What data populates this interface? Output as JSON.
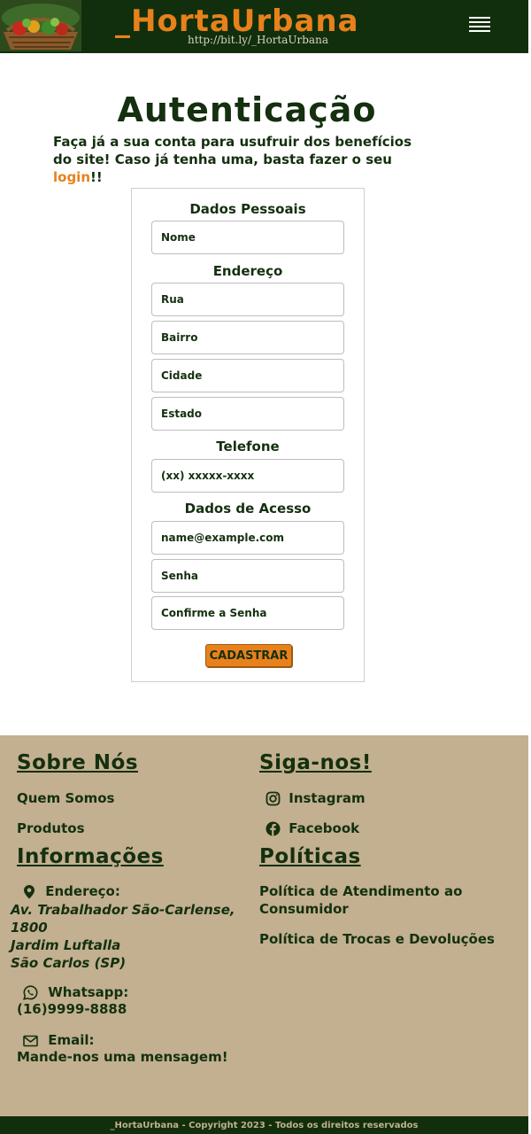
{
  "header": {
    "brand": "_HortaUrbana",
    "brand_url": "http://bit.ly/_HortaUrbana",
    "menu_icon": "hamburger-icon"
  },
  "auth": {
    "title": "Autenticação",
    "intro_text": "Faça já a sua conta para usufruir dos benefícios do site! Caso já tenha uma, basta fazer o seu ",
    "login_link": "login",
    "intro_end": "!!"
  },
  "form": {
    "personal_label": "Dados Pessoais",
    "name_placeholder": "Nome",
    "address_label": "Endereço",
    "street_placeholder": "Rua",
    "neighborhood_placeholder": "Bairro",
    "city_placeholder": "Cidade",
    "state_placeholder": "Estado",
    "phone_label": "Telefone",
    "phone_placeholder": "(xx) xxxxx-xxxx",
    "access_label": "Dados de Acesso",
    "email_placeholder": "name@example.com",
    "password_placeholder": "Senha",
    "confirm_placeholder": "Confirme a Senha",
    "submit_label": "CADASTRAR"
  },
  "footer": {
    "about_title": "Sobre Nós",
    "about_links": [
      "Quem Somos",
      "Produtos"
    ],
    "follow_title": "Siga-nos!",
    "instagram": "Instagram",
    "facebook": "Facebook",
    "info_title": "Informações",
    "address_label": "Endereço:",
    "address_lines": [
      "Av. Trabalhador São-Carlense,",
      "1800",
      "Jardim Luftalla",
      "São Carlos (SP)"
    ],
    "whatsapp_label": "Whatsapp:",
    "whatsapp_number": "(16)9999-8888",
    "email_label": "Email:",
    "email_link": "Mande-nos uma mensagem!",
    "policies_title": "Políticas",
    "policy_links": [
      "Política de Atendimento ao Consumidor",
      "Política de Trocas e Devoluções"
    ],
    "copyright": "_HortaUrbana - Copyright 2023 - Todos os direitos reservados"
  },
  "colors": {
    "header_bg": "#112f0c",
    "accent": "#e8811b",
    "footer_bg": "#c2b090",
    "text": "#14300f"
  }
}
